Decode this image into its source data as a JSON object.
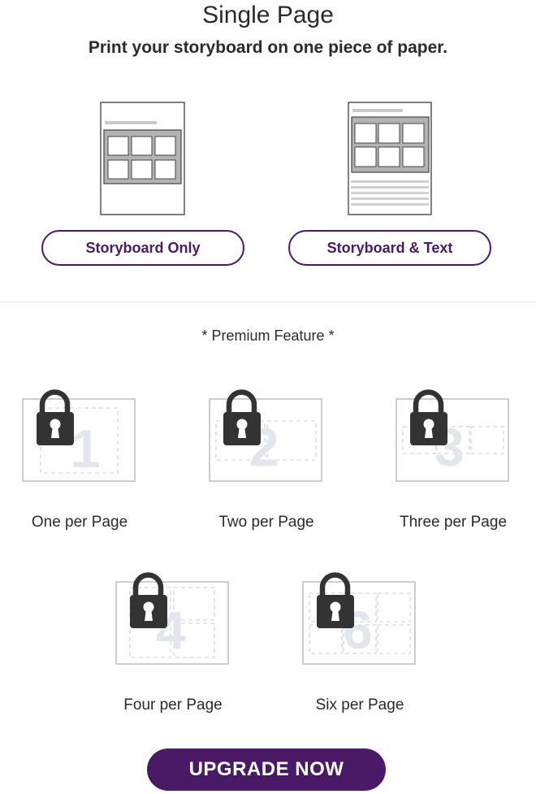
{
  "header": {
    "title": "Single Page",
    "subtitle": "Print your storyboard on one piece of paper."
  },
  "options": [
    {
      "label": "Storyboard Only"
    },
    {
      "label": "Storyboard & Text"
    }
  ],
  "premium": {
    "label": "* Premium Feature *",
    "layouts": [
      {
        "label": "One per Page",
        "number": "1"
      },
      {
        "label": "Two per Page",
        "number": "2"
      },
      {
        "label": "Three per Page",
        "number": "3"
      },
      {
        "label": "Four per Page",
        "number": "4"
      },
      {
        "label": "Six per Page",
        "number": "6"
      }
    ]
  },
  "upgrade_label": "UPGRADE NOW",
  "colors": {
    "brand_purple": "#4a1a66",
    "lock": "#333333",
    "page_outline": "#bdbdbd",
    "dashed_cell": "#d3d6dc",
    "watermark_number": "#e3e6ec"
  },
  "icons": {
    "lock": "lock-icon"
  }
}
